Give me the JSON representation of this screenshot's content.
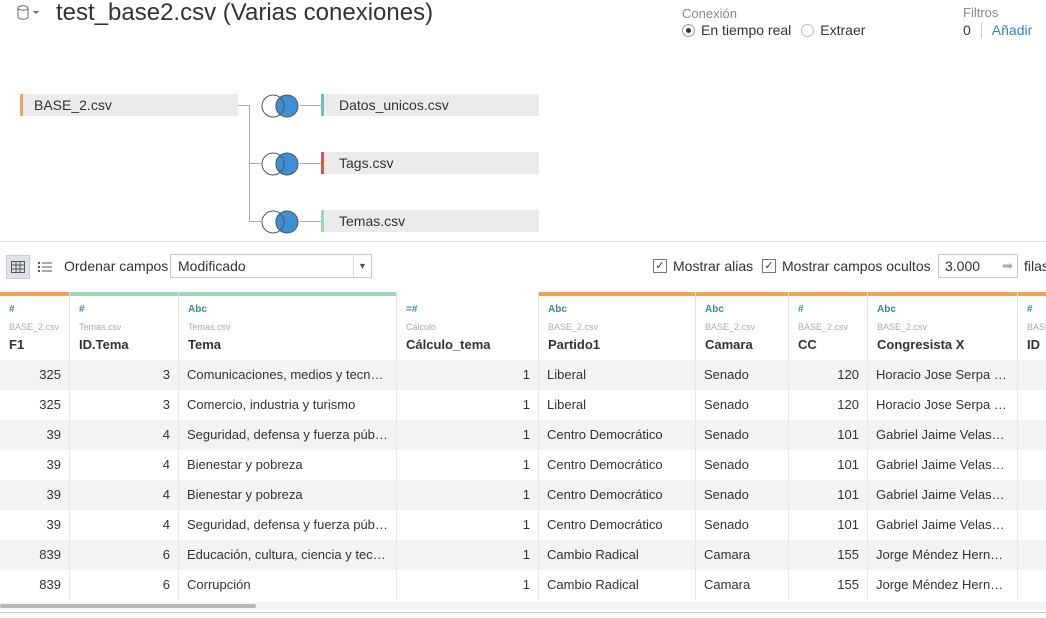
{
  "header": {
    "title": "test_base2.csv (Varias conexiones)",
    "db_icon": "database-icon",
    "connection": {
      "label": "Conexión",
      "options": [
        "En tiempo real",
        "Extraer"
      ],
      "selected": "En tiempo real"
    },
    "filters": {
      "label": "Filtros",
      "count": "0",
      "add_label": "Añadir"
    }
  },
  "canvas": {
    "primary_table": {
      "name": "BASE_2.csv",
      "color": "#f0a35a"
    },
    "joined_tables": [
      {
        "name": "Datos_unicos.csv",
        "color": "#6cc1c1"
      },
      {
        "name": "Tags.csv",
        "color": "#d9534f"
      },
      {
        "name": "Temas.csv",
        "color": "#9fd5b8"
      }
    ],
    "join_icon": "join-venn-icon",
    "join_colors": {
      "left": "#ffffff",
      "right": "#3d8fd6"
    }
  },
  "toolbar": {
    "grid_view_icon": "grid-view-icon",
    "list_view_icon": "list-view-icon",
    "sort_label": "Ordenar campos",
    "sort_value": "Modificado",
    "show_alias_label": "Mostrar alias",
    "show_alias_checked": true,
    "show_hidden_label": "Mostrar campos ocultos",
    "show_hidden_checked": true,
    "rows_value": "3.000",
    "rows_label": "filas"
  },
  "grid": {
    "columns": [
      {
        "type": "#",
        "type_color": "#3e8a8a",
        "source": "BASE_2.csv",
        "name": "F1",
        "bar": "#f0a35a",
        "align": "num"
      },
      {
        "type": "#",
        "type_color": "#3e8a8a",
        "source": "Temas.csv",
        "name": "ID.Tema",
        "bar": "#9fd5b8",
        "align": "num"
      },
      {
        "type": "Abc",
        "type_color": "#3e8a8a",
        "source": "Temas.csv",
        "name": "Tema",
        "bar": "#9fd5b8",
        "align": "text"
      },
      {
        "type": "=#",
        "type_color": "#3e8a8a",
        "source": "Cálculo",
        "name": "Cálculo_tema",
        "bar": "#ffffff",
        "align": "num"
      },
      {
        "type": "Abc",
        "type_color": "#3e8a8a",
        "source": "BASE_2.csv",
        "name": "Partido1",
        "bar": "#f0a35a",
        "align": "text"
      },
      {
        "type": "Abc",
        "type_color": "#3e8a8a",
        "source": "BASE_2.csv",
        "name": "Camara",
        "bar": "#f0a35a",
        "align": "text"
      },
      {
        "type": "#",
        "type_color": "#3e8a8a",
        "source": "BASE_2.csv",
        "name": "CC",
        "bar": "#f0a35a",
        "align": "num"
      },
      {
        "type": "Abc",
        "type_color": "#3e8a8a",
        "source": "BASE_2.csv",
        "name": "Congresista X",
        "bar": "#f0a35a",
        "align": "text"
      },
      {
        "type": "#",
        "type_color": "#3e8a8a",
        "source": "BASE_2.csv",
        "name": "ID",
        "bar": "#f0a35a",
        "align": "text"
      }
    ],
    "rows": [
      [
        "325",
        "3",
        "Comunicaciones, medios y tecnolo...",
        "1",
        "Liberal",
        "Senado",
        "120",
        "Horacio Jose Serpa M...",
        ""
      ],
      [
        "325",
        "3",
        "Comercio, industria y turismo",
        "1",
        "Liberal",
        "Senado",
        "120",
        "Horacio Jose Serpa M...",
        ""
      ],
      [
        "39",
        "4",
        "Seguridad, defensa y fuerza pública",
        "1",
        "Centro Democrático",
        "Senado",
        "101",
        "Gabriel Jaime Velasco...",
        ""
      ],
      [
        "39",
        "4",
        "Bienestar y pobreza",
        "1",
        "Centro Democrático",
        "Senado",
        "101",
        "Gabriel Jaime Velasco...",
        ""
      ],
      [
        "39",
        "4",
        "Bienestar y pobreza",
        "1",
        "Centro Democrático",
        "Senado",
        "101",
        "Gabriel Jaime Velasco...",
        ""
      ],
      [
        "39",
        "4",
        "Seguridad, defensa y fuerza pública",
        "1",
        "Centro Democrático",
        "Senado",
        "101",
        "Gabriel Jaime Velasco...",
        ""
      ],
      [
        "839",
        "6",
        "Educación, cultura, ciencia y tecn...",
        "1",
        "Cambio Radical",
        "Camara",
        "155",
        "Jorge Méndez Hernán...",
        ""
      ],
      [
        "839",
        "6",
        "Corrupción",
        "1",
        "Cambio Radical",
        "Camara",
        "155",
        "Jorge Méndez Hernán...",
        ""
      ]
    ]
  }
}
